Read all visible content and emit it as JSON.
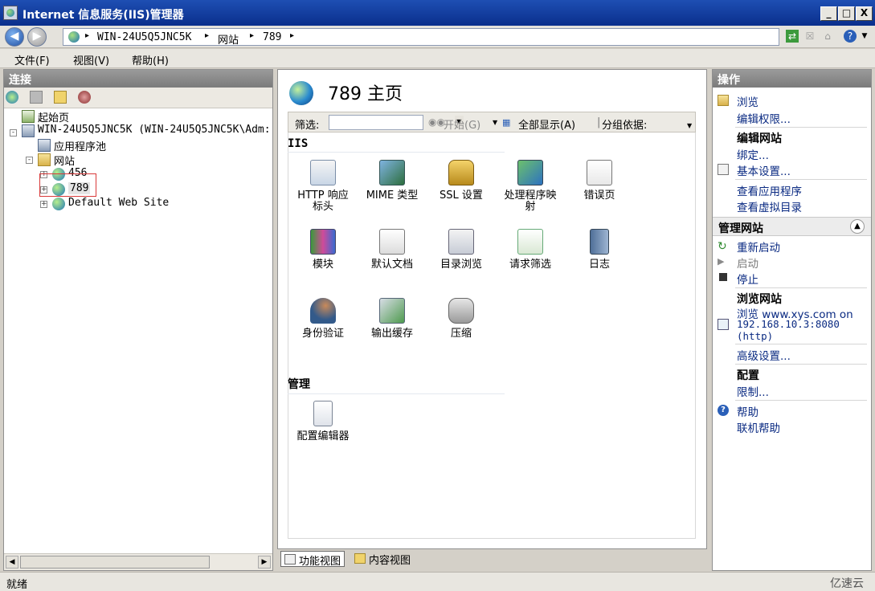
{
  "window": {
    "title": "Internet 信息服务(IIS)管理器",
    "controls": [
      "_",
      "□",
      "X"
    ]
  },
  "address": {
    "crumbs": [
      "WIN-24U5Q5JNC5K",
      "网站",
      "789"
    ],
    "separator": "▸"
  },
  "menu": {
    "items": [
      "文件(F)",
      "视图(V)",
      "帮助(H)"
    ]
  },
  "connections": {
    "title": "连接",
    "tree": [
      {
        "label": "起始页",
        "icon": "start-page-icon"
      },
      {
        "label": "WIN-24U5Q5JNC5K (WIN-24U5Q5JNC5K\\Adm:",
        "icon": "server-icon",
        "expander": "-"
      },
      {
        "label": "应用程序池",
        "icon": "app-pool-icon"
      },
      {
        "label": "网站",
        "icon": "sites-folder-icon",
        "expander": "-"
      },
      {
        "label": "456",
        "icon": "globe-icon",
        "expander": "+"
      },
      {
        "label": "789",
        "icon": "globe-icon",
        "expander": "+",
        "highlighted": true
      },
      {
        "label": "Default Web Site",
        "icon": "globe-icon",
        "expander": "+"
      }
    ]
  },
  "center": {
    "title": "789 主页",
    "filter": {
      "label": "筛选:",
      "input_value": "",
      "start": "开始(G)",
      "show_all": "全部显示(A)",
      "group_by": "分组依据:"
    },
    "groups": [
      {
        "name": "IIS",
        "features": [
          {
            "label": "HTTP 响应\n标头",
            "icon": "http-headers-icon"
          },
          {
            "label": "MIME 类型",
            "icon": "mime-types-icon"
          },
          {
            "label": "SSL 设置",
            "icon": "ssl-lock-icon"
          },
          {
            "label": "处理程序映\n射",
            "icon": "handler-mappings-icon"
          },
          {
            "label": "错误页",
            "icon": "error-pages-icon"
          },
          {
            "label": "模块",
            "icon": "modules-icon"
          },
          {
            "label": "默认文档",
            "icon": "default-document-icon"
          },
          {
            "label": "目录浏览",
            "icon": "directory-browsing-icon"
          },
          {
            "label": "请求筛选",
            "icon": "request-filtering-icon"
          },
          {
            "label": "日志",
            "icon": "logging-icon"
          },
          {
            "label": "身份验证",
            "icon": "authentication-icon"
          },
          {
            "label": "输出缓存",
            "icon": "output-caching-icon"
          },
          {
            "label": "压缩",
            "icon": "compression-icon"
          }
        ]
      },
      {
        "name": "管理",
        "features": [
          {
            "label": "配置编辑器",
            "icon": "config-editor-icon"
          }
        ]
      }
    ],
    "tabs": [
      "功能视图",
      "内容视图"
    ]
  },
  "actions": {
    "title": "操作",
    "browse": "浏览",
    "edit_permissions": "编辑权限...",
    "edit_site_header": "编辑网站",
    "bindings": "绑定...",
    "basic_settings": "基本设置...",
    "view_apps": "查看应用程序",
    "view_vdirs": "查看虚拟目录",
    "manage_site_header": "管理网站",
    "restart": "重新启动",
    "start": "启动",
    "stop": "停止",
    "browse_site_header": "浏览网站",
    "browse_link_1": "浏览 www.xys.com on",
    "browse_link_2": "192.168.10.3:8080",
    "browse_link_3": "(http)",
    "advanced_settings": "高级设置...",
    "config_header": "配置",
    "limits": "限制...",
    "help": "帮助",
    "online_help": "联机帮助"
  },
  "status": {
    "text": "就绪",
    "watermark": "亿速云"
  },
  "colors": {
    "titlebar": "#0a2f8c",
    "link": "#0a2a82",
    "highlight_box": "#d93a3a"
  }
}
